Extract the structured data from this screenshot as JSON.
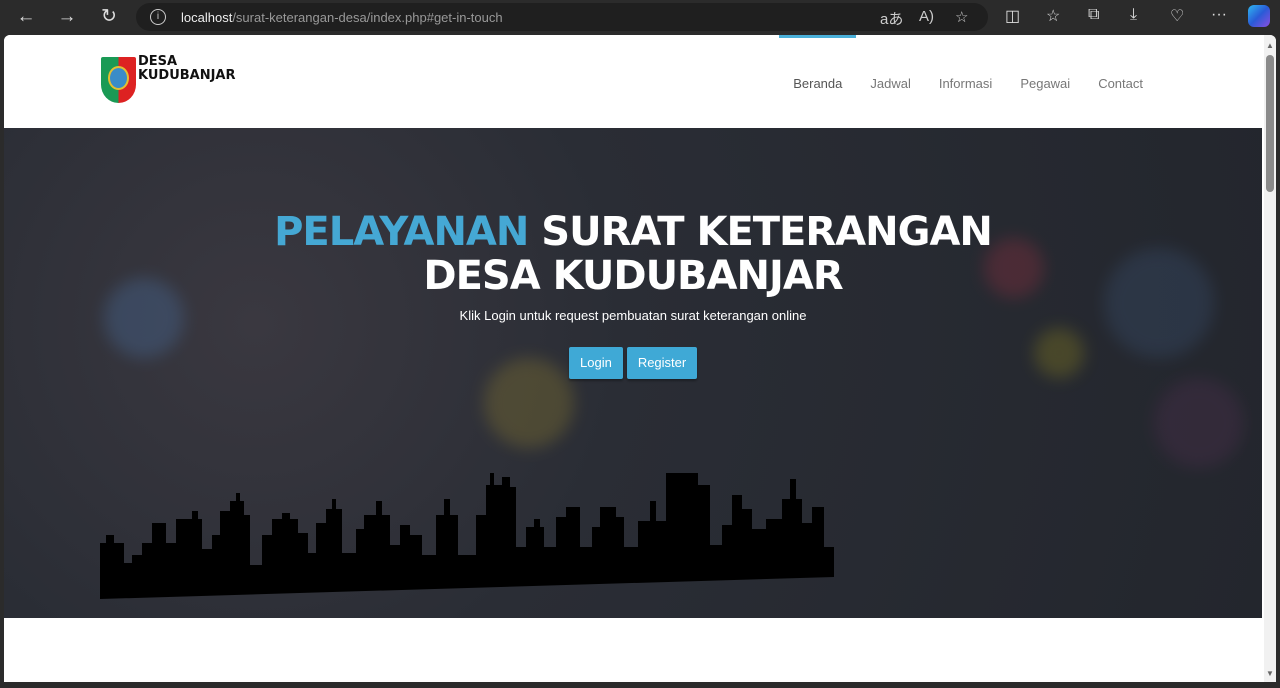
{
  "browser": {
    "url_host": "localhost",
    "url_path": "/surat-keterangan-desa/index.php#get-in-touch"
  },
  "site": {
    "logo_line1": "DESA",
    "logo_line2": "KUDUBANJAR"
  },
  "nav": [
    {
      "label": "Beranda"
    },
    {
      "label": "Jadwal"
    },
    {
      "label": "Informasi"
    },
    {
      "label": "Pegawai"
    },
    {
      "label": "Contact"
    }
  ],
  "hero": {
    "title_highlight": "PELAYANAN",
    "title_rest": "SURAT KETERANGAN",
    "title_line2": "DESA KUDUBANJAR",
    "subtitle": "Klik Login untuk request pembuatan surat keterangan online",
    "login": "Login",
    "register": "Register"
  },
  "colors": {
    "accent": "#45a8d4"
  }
}
